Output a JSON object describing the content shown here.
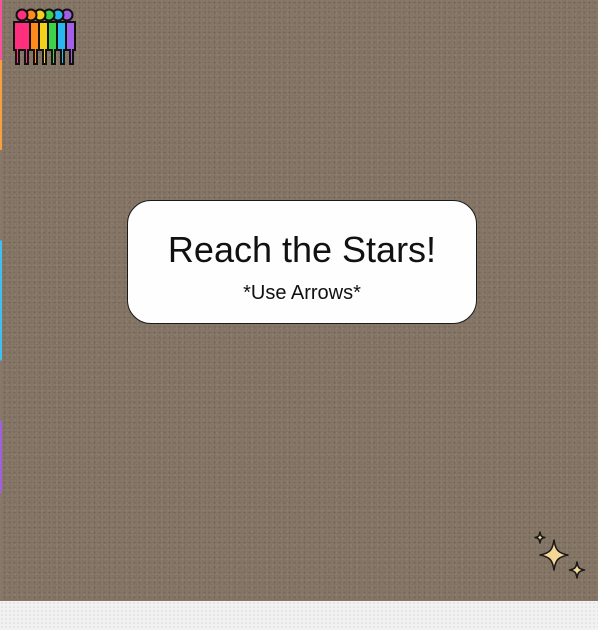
{
  "game": {
    "title": "Reach the Stars!",
    "instructions": "*Use Arrows*"
  },
  "icons": {
    "logo": "rainbow-people-icon",
    "goal": "sparkle-stars-icon"
  },
  "colors": {
    "background": "#887868",
    "panel": "#fefefe",
    "star_fill": "#f6d896",
    "figures": [
      "#ff2f7e",
      "#ff8a1e",
      "#f4d21c",
      "#3fd14a",
      "#2ab7f0",
      "#a45ee8"
    ]
  }
}
